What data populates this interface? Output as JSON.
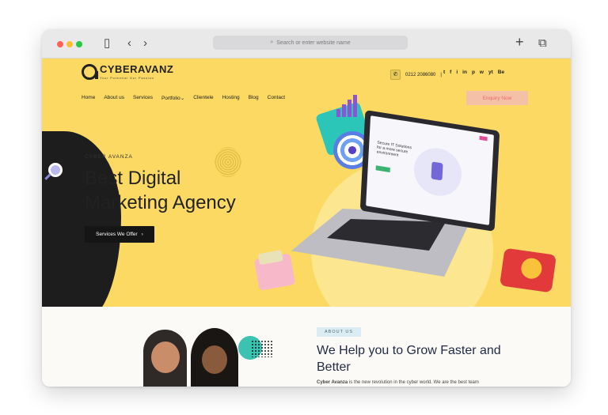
{
  "browser": {
    "address_placeholder": "Search or enter website name",
    "icons": [
      "sidebar-icon",
      "back-icon",
      "forward-icon",
      "search-icon",
      "new-tab-icon",
      "tabs-icon"
    ]
  },
  "header": {
    "logo_text_a": "CYBER",
    "logo_text_b": "AVANZ",
    "tagline": "Your Potential Our Passion",
    "phone": "0212 2086080",
    "socials": [
      "t",
      "f",
      "i",
      "in",
      "p",
      "w",
      "yt",
      "Be"
    ],
    "nav": [
      "Home",
      "About us",
      "Services",
      "Portfolio",
      "Clientele",
      "Hosting",
      "Blog",
      "Contact"
    ],
    "portfolio_caret": "⌄",
    "enquiry_label": "Enquiry Now"
  },
  "hero": {
    "eyebrow": "CYBER AVANZA",
    "title_line1": "Best Digital",
    "title_line2": "Marketing Agency",
    "cta_label": "Services We Offer",
    "cta_arrow": "›",
    "screen_heading": "Secure IT Solutions for a more secure environment"
  },
  "about": {
    "pill": "ABOUT US",
    "heading_line1": "We Help you to Grow Faster and",
    "heading_line2": "Better",
    "para_bold": "Cyber Avanza",
    "para_rest": " is the new revolution in the cyber world. We are the best team"
  },
  "colors": {
    "hero_bg": "#fbd962",
    "cta_bg": "#151515",
    "enquiry_bg": "#f5c0a8",
    "heading": "#1f2a44"
  }
}
